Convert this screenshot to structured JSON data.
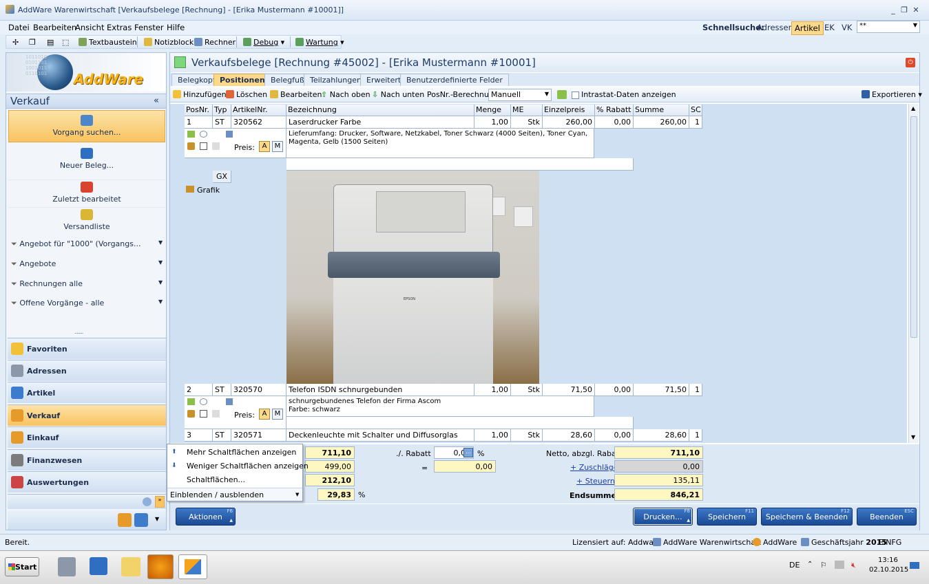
{
  "window": {
    "title": "AddWare Warenwirtschaft [Verkaufsbelege [Rechnung] - [Erika Mustermann #10001]]"
  },
  "menu": {
    "items": [
      "Datei",
      "Bearbeiten",
      "Ansicht",
      "Extras",
      "Fenster",
      "Hilfe"
    ]
  },
  "quicksearch": {
    "label": "Schnellsuche:",
    "options": [
      "Adressen",
      "Artikel",
      "EK",
      "VK"
    ],
    "selected": "Artikel",
    "value": "**"
  },
  "toolbar": {
    "textbaustein": "Textbaustein",
    "notizblock": "Notizblock",
    "rechner": "Rechner",
    "debug": "Debug",
    "wartung": "Wartung"
  },
  "logo": {
    "text": "AddWare"
  },
  "sidebar": {
    "header": "Verkauf",
    "collapse": "«",
    "big_items": [
      "Vorgang suchen...",
      "Neuer Beleg...",
      "Zuletzt bearbeitet",
      "Versandliste"
    ],
    "filters": [
      "Angebot für \"1000\" (Vorgangs...",
      "Angebote",
      "Rechnungen alle",
      "Offene Vorgänge - alle"
    ],
    "grip": "........",
    "nav": [
      "Favoriten",
      "Adressen",
      "Artikel",
      "Verkauf",
      "Einkauf",
      "Finanzwesen",
      "Auswertungen"
    ]
  },
  "doc": {
    "title": "Verkaufsbelege [Rechnung #45002] - [Erika Mustermann #10001]"
  },
  "tabs": [
    "Belegkopf",
    "Positionen",
    "Belegfuß",
    "Teilzahlungen",
    "Erweitert",
    "Benutzerdefinierte Felder"
  ],
  "postoolbar": {
    "add": "Hinzufügen",
    "delete": "Löschen",
    "edit": "Bearbeiten",
    "up": "Nach oben",
    "down": "Nach unten",
    "calc_label": "PosNr.-Berechnung",
    "calc_value": "Manuell",
    "intrastat": "Intrastat-Daten anzeigen",
    "export": "Exportieren"
  },
  "grid": {
    "headers": [
      "PosNr.",
      "Typ",
      "ArtikelNr.",
      "Bezeichnung",
      "Menge",
      "ME",
      "Einzelpreis",
      "% Rabatt",
      "Summe",
      "SC"
    ],
    "rows": [
      {
        "pos": "1",
        "typ": "ST",
        "nr": "320562",
        "bez": "Laserdrucker Farbe",
        "menge": "1,00",
        "me": "Stk",
        "preis": "260,00",
        "rabatt": "0,00",
        "summe": "260,00",
        "sc": "1",
        "text": "Lieferumfang: Drucker, Software, Netzkabel, Toner Schwarz (4000 Seiten), Toner Cyan, Magenta, Gelb (1500 Seiten)"
      },
      {
        "pos": "2",
        "typ": "ST",
        "nr": "320570",
        "bez": "Telefon ISDN schnurgebunden",
        "menge": "1,00",
        "me": "Stk",
        "preis": "71,50",
        "rabatt": "0,00",
        "summe": "71,50",
        "sc": "1",
        "text": "schnurgebundenes Telefon der Firma Ascom\nFarbe: schwarz"
      },
      {
        "pos": "3",
        "typ": "ST",
        "nr": "320571",
        "bez": "Deckenleuchte mit Schalter und Diffusorglas",
        "menge": "1,00",
        "me": "Stk",
        "preis": "28,60",
        "rabatt": "0,00",
        "summe": "28,60",
        "sc": "1",
        "text": ""
      }
    ],
    "preis_label": "Preis:",
    "btn_a": "A",
    "btn_m": "M",
    "gx": "GX",
    "grafik": "Grafik",
    "printer_brand": "EPSON"
  },
  "summary": {
    "v1": "711,10",
    "v2": "499,00",
    "v3": "212,10",
    "v4": "29,83",
    "pct": "%",
    "rabatt_label": "./. Rabatt",
    "rabatt_value": "0,00",
    "rabatt_pct": "%",
    "eq": "=",
    "rabatt_amount": "0,00",
    "netto_label": "Netto, abzgl. Rabatt",
    "netto": "711,10",
    "zuschlaege_label": "+ Zuschläge",
    "zuschlaege": "0,00",
    "steuern_label": "+ Steuern",
    "steuern": "135,11",
    "end_label": "Endsumme",
    "end": "846,21"
  },
  "popup": {
    "items": [
      "Mehr Schaltflächen anzeigen",
      "Weniger Schaltflächen anzeigen",
      "Schaltflächen..."
    ],
    "footer": "Einblenden / ausblenden"
  },
  "buttons": {
    "aktionen": "Aktionen",
    "aktionen_key": "F6",
    "drucken": "Drucken...",
    "drucken_key": "F8",
    "speichern": "Speichern",
    "speichern_key": "F11",
    "speichern_beenden": "Speichern & Beenden",
    "speichern_beenden_key": "F12",
    "beenden": "Beenden",
    "beenden_key": "ESC"
  },
  "status": {
    "ready": "Bereit.",
    "license": "Lizensiert auf: Addware",
    "app": "AddWare Warenwirtschaft",
    "user": "AddWare",
    "year_label": "Geschäftsjahr",
    "year": "2015",
    "mode": "EINFG"
  },
  "taskbar": {
    "start": "Start",
    "lang": "DE",
    "time": "13:16",
    "date": "02.10.2015"
  },
  "colors": {
    "accent": "#fbd98a",
    "nav_active": "#f9c360",
    "button": "#1a4a93",
    "grid_bg": "#cfe0f3"
  }
}
